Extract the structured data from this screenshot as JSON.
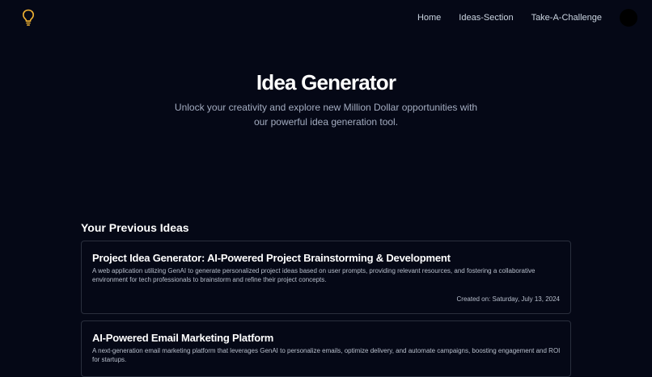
{
  "nav": {
    "logo_icon": "lightbulb-icon",
    "links": [
      "Home",
      "Ideas-Section",
      "Take-A-Challenge"
    ]
  },
  "hero": {
    "title": "Idea Generator",
    "subtitle": "Unlock your creativity and explore new Million Dollar opportunities with our powerful idea generation tool."
  },
  "ideas": {
    "section_title": "Your Previous Ideas",
    "items": [
      {
        "title": "Project Idea Generator: AI-Powered Project Brainstorming & Development",
        "description": "A web application utilizing GenAI to generate personalized project ideas based on user prompts, providing relevant resources, and fostering a collaborative environment for tech professionals to brainstorm and refine their project concepts.",
        "created": "Created on: Saturday, July 13, 2024"
      },
      {
        "title": "AI-Powered Email Marketing Platform",
        "description": "A next-generation email marketing platform that leverages GenAI to personalize emails, optimize delivery, and automate campaigns, boosting engagement and ROI for startups."
      }
    ]
  },
  "colors": {
    "background": "#050816",
    "accent": "#f5b533",
    "text": "#ffffff",
    "muted": "#a3acc0"
  }
}
